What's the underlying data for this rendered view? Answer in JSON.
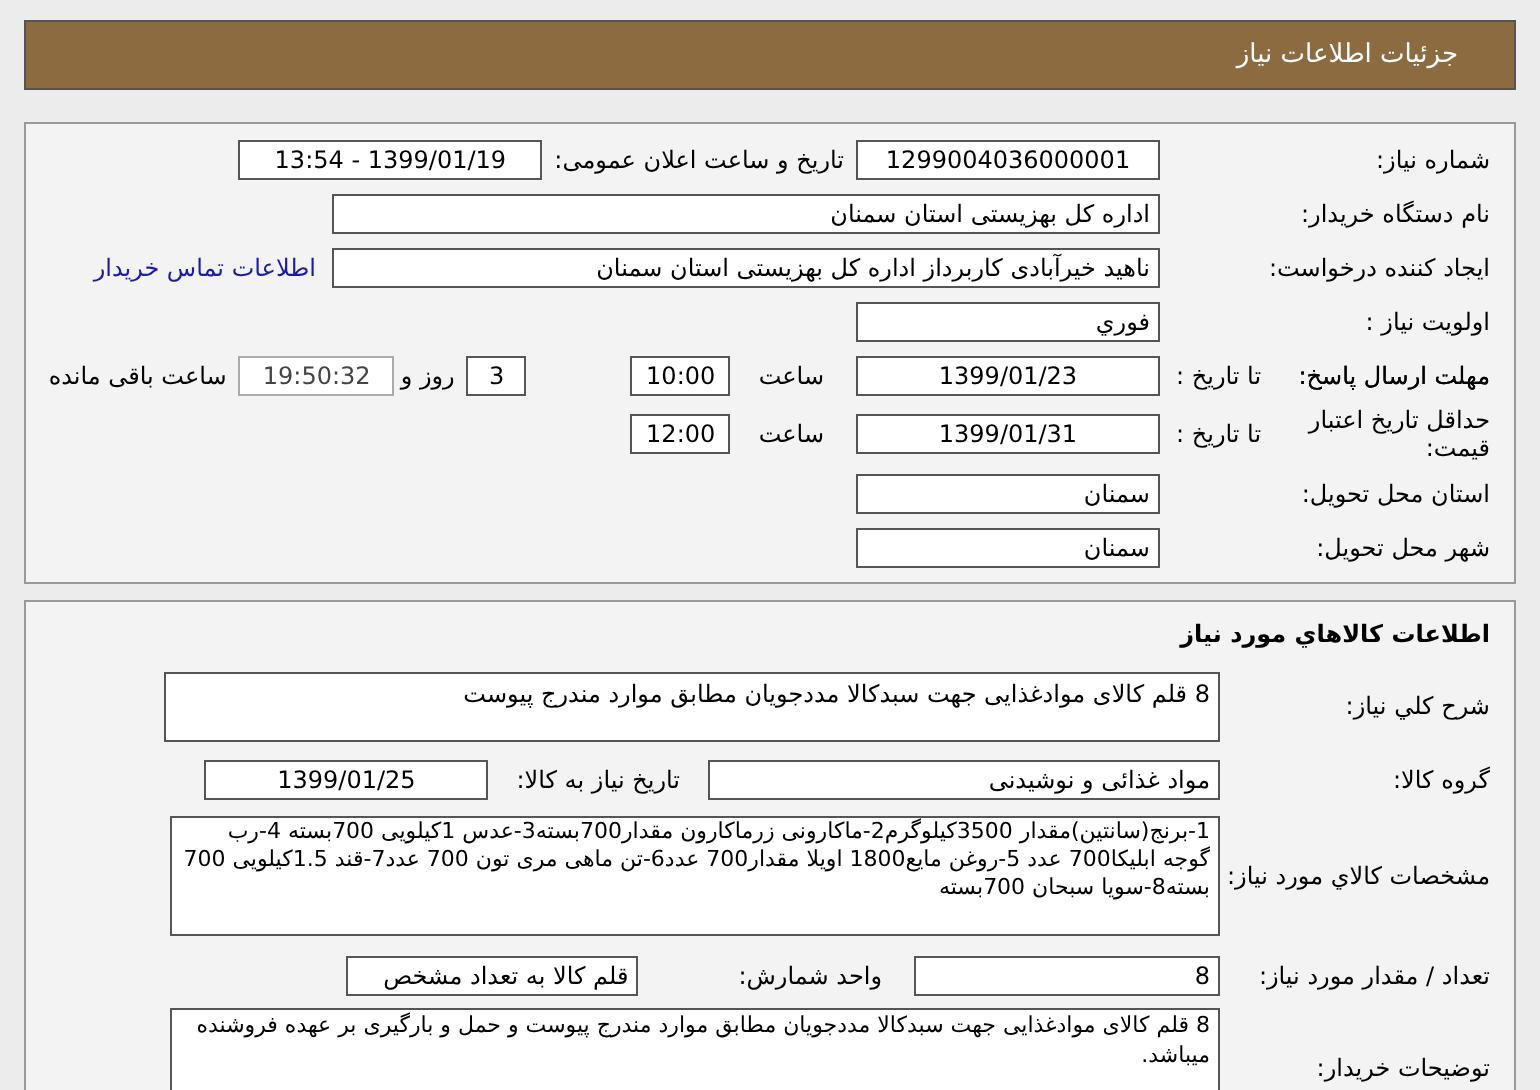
{
  "header": {
    "title": "جزئیات اطلاعات نیاز"
  },
  "need_details": {
    "need_number": {
      "label": "شماره نیاز:",
      "value": "1299004036000001"
    },
    "announce": {
      "label": "تاریخ و ساعت اعلان عمومی:",
      "value": "1399/01/19 - 13:54"
    },
    "buyer": {
      "label": "نام دستگاه خریدار:",
      "value": "اداره کل بهزیستی استان سمنان"
    },
    "creator": {
      "label": "ایجاد کننده درخواست:",
      "value": "ناهید خیرآبادی کاربرداز اداره کل بهزیستی استان سمنان",
      "link": "اطلاعات تماس خریدار"
    },
    "priority": {
      "label": "اولویت نیاز :",
      "value": "فوري"
    },
    "deadline": {
      "label": "مهلت ارسال پاسخ:",
      "to_date_label": "تا تاریخ :",
      "date": "1399/01/23",
      "time_label": "ساعت",
      "time": "10:00",
      "days": "3",
      "days_label": "روز و",
      "remaining": "19:50:32",
      "remaining_label": "ساعت باقی مانده"
    },
    "validity": {
      "label": "حداقل تاریخ اعتبار قیمت:",
      "to_date_label": "تا تاریخ :",
      "date": "1399/01/31",
      "time_label": "ساعت",
      "time": "12:00"
    },
    "province": {
      "label": "استان محل تحویل:",
      "value": "سمنان"
    },
    "city": {
      "label": "شهر محل تحویل:",
      "value": "سمنان"
    }
  },
  "goods": {
    "title": "اطلاعات کالاهاي مورد نياز",
    "description": {
      "label": "شرح کلي نياز:",
      "value": "8 قلم کالای موادغذایی جهت سبدکالا مددجویان مطابق موارد مندرج پیوست"
    },
    "group": {
      "label": "گروه کالا:",
      "value": "مواد غذائی و نوشیدنی"
    },
    "need_date": {
      "label": "تاريخ نياز به کالا:",
      "value": "1399/01/25"
    },
    "specs": {
      "label": "مشخصات کالاي مورد نياز:",
      "value": "1-برنج(سانتین)مقدار 3500کیلوگرم2-ماکارونی زرماکارون مقدار700بسته3-عدس 1کیلویی 700بسته 4-رب گوجه ابلیکا700 عدد 5-روغن مایع1800 اویلا مقدار700 عدد6-تن ماهی مری تون 700 عدد7-قند 1.5کیلویی 700 بسته8-سویا سبحان 700بسته"
    },
    "quantity": {
      "label": "تعداد / مقدار مورد نیاز:",
      "value": "8"
    },
    "unit": {
      "label": "واحد شمارش:",
      "value": "قلم کالا به تعداد مشخص"
    },
    "buyer_notes": {
      "label": "توضیحات خریدار:",
      "value": "8 قلم کالای موادغذایی جهت سبدکالا مددجویان مطابق موارد مندرج پیوست و حمل و بارگیری بر عهده فروشنده میباشد."
    }
  }
}
